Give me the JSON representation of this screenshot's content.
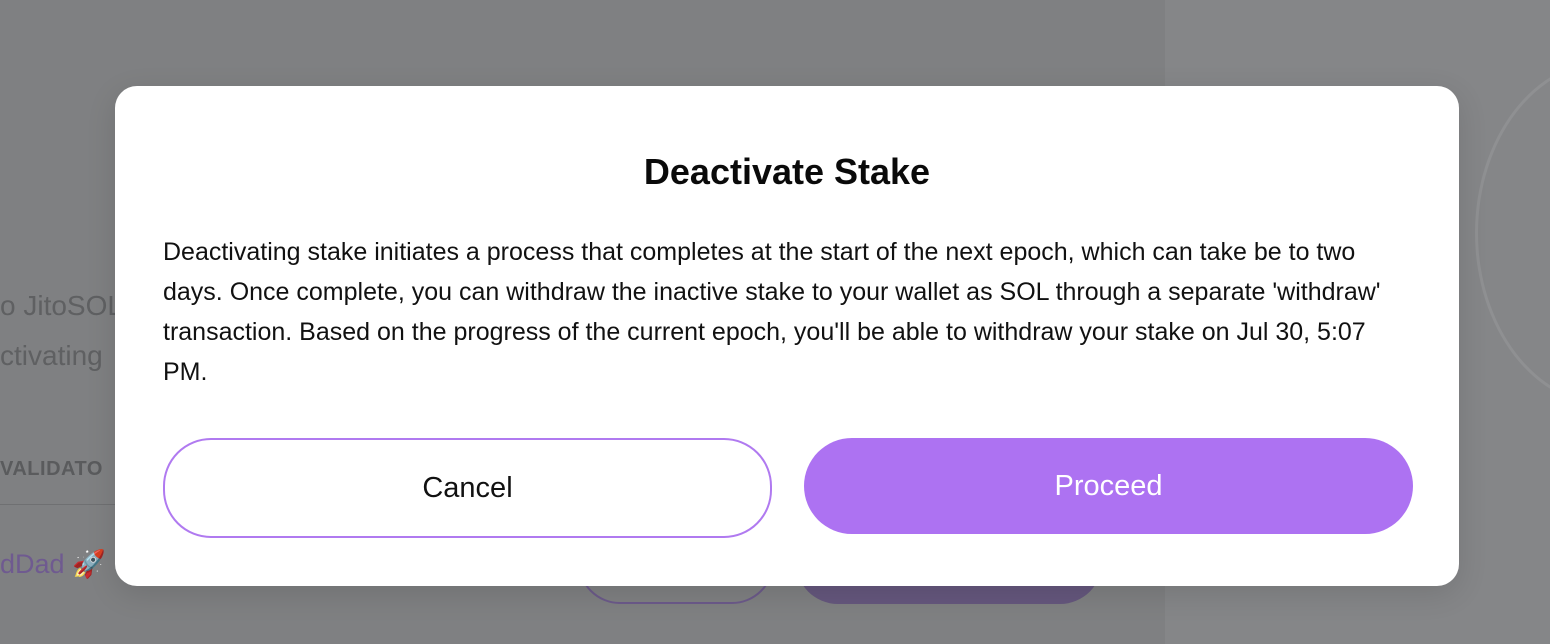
{
  "background": {
    "text_line_1": "o JitoSOL",
    "text_line_2": "ctivating",
    "column_header": "VALIDATO",
    "validator_name": "dDad 🚀"
  },
  "modal": {
    "title": "Deactivate Stake",
    "body": "Deactivating stake initiates a process that completes at the start of the next epoch, which can take be to two days. Once complete, you can withdraw the inactive stake to your wallet as SOL through a separate 'withdraw' transaction. Based on the progress of the current epoch, you'll be able to withdraw your stake on Jul 30, 5:07 PM.",
    "cancel_label": "Cancel",
    "proceed_label": "Proceed"
  },
  "colors": {
    "accent": "#ad72f2",
    "accent_border": "#b07af0",
    "overlay": "#7f8082"
  }
}
